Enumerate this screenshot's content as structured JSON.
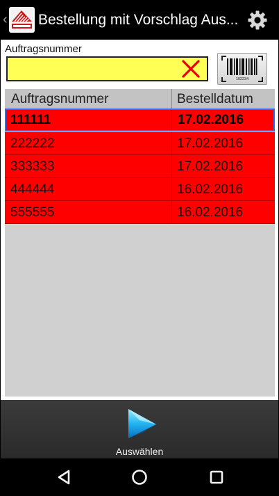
{
  "app": {
    "title": "Bestellung mit Vorschlag Aus...",
    "logo_icon": "cosys-logo",
    "settings_icon": "gear-icon"
  },
  "form": {
    "field_label": "Auftragsnummer",
    "field_value": "",
    "field_background": "#ffff55",
    "clear_icon": "close-icon",
    "barcode_icon": "barcode-scan-icon",
    "barcode_caption": "102234"
  },
  "table": {
    "headers": [
      "Auftragsnummer",
      "Bestelldatum"
    ],
    "rows": [
      {
        "order_number": "111111",
        "date": "17.02.2016"
      },
      {
        "order_number": "222222",
        "date": "17.02.2016"
      },
      {
        "order_number": "333333",
        "date": "17.02.2016"
      },
      {
        "order_number": "444444",
        "date": "16.02.2016"
      },
      {
        "order_number": "555555",
        "date": "16.02.2016"
      }
    ],
    "selected_row": 0,
    "row_color": "#ff0000"
  },
  "actions": {
    "select_label": "Auswählen",
    "select_icon": "play-triangle-icon"
  },
  "navbar": {
    "back_icon": "nav-back-icon",
    "home_icon": "nav-home-icon",
    "recents_icon": "nav-recents-icon"
  }
}
